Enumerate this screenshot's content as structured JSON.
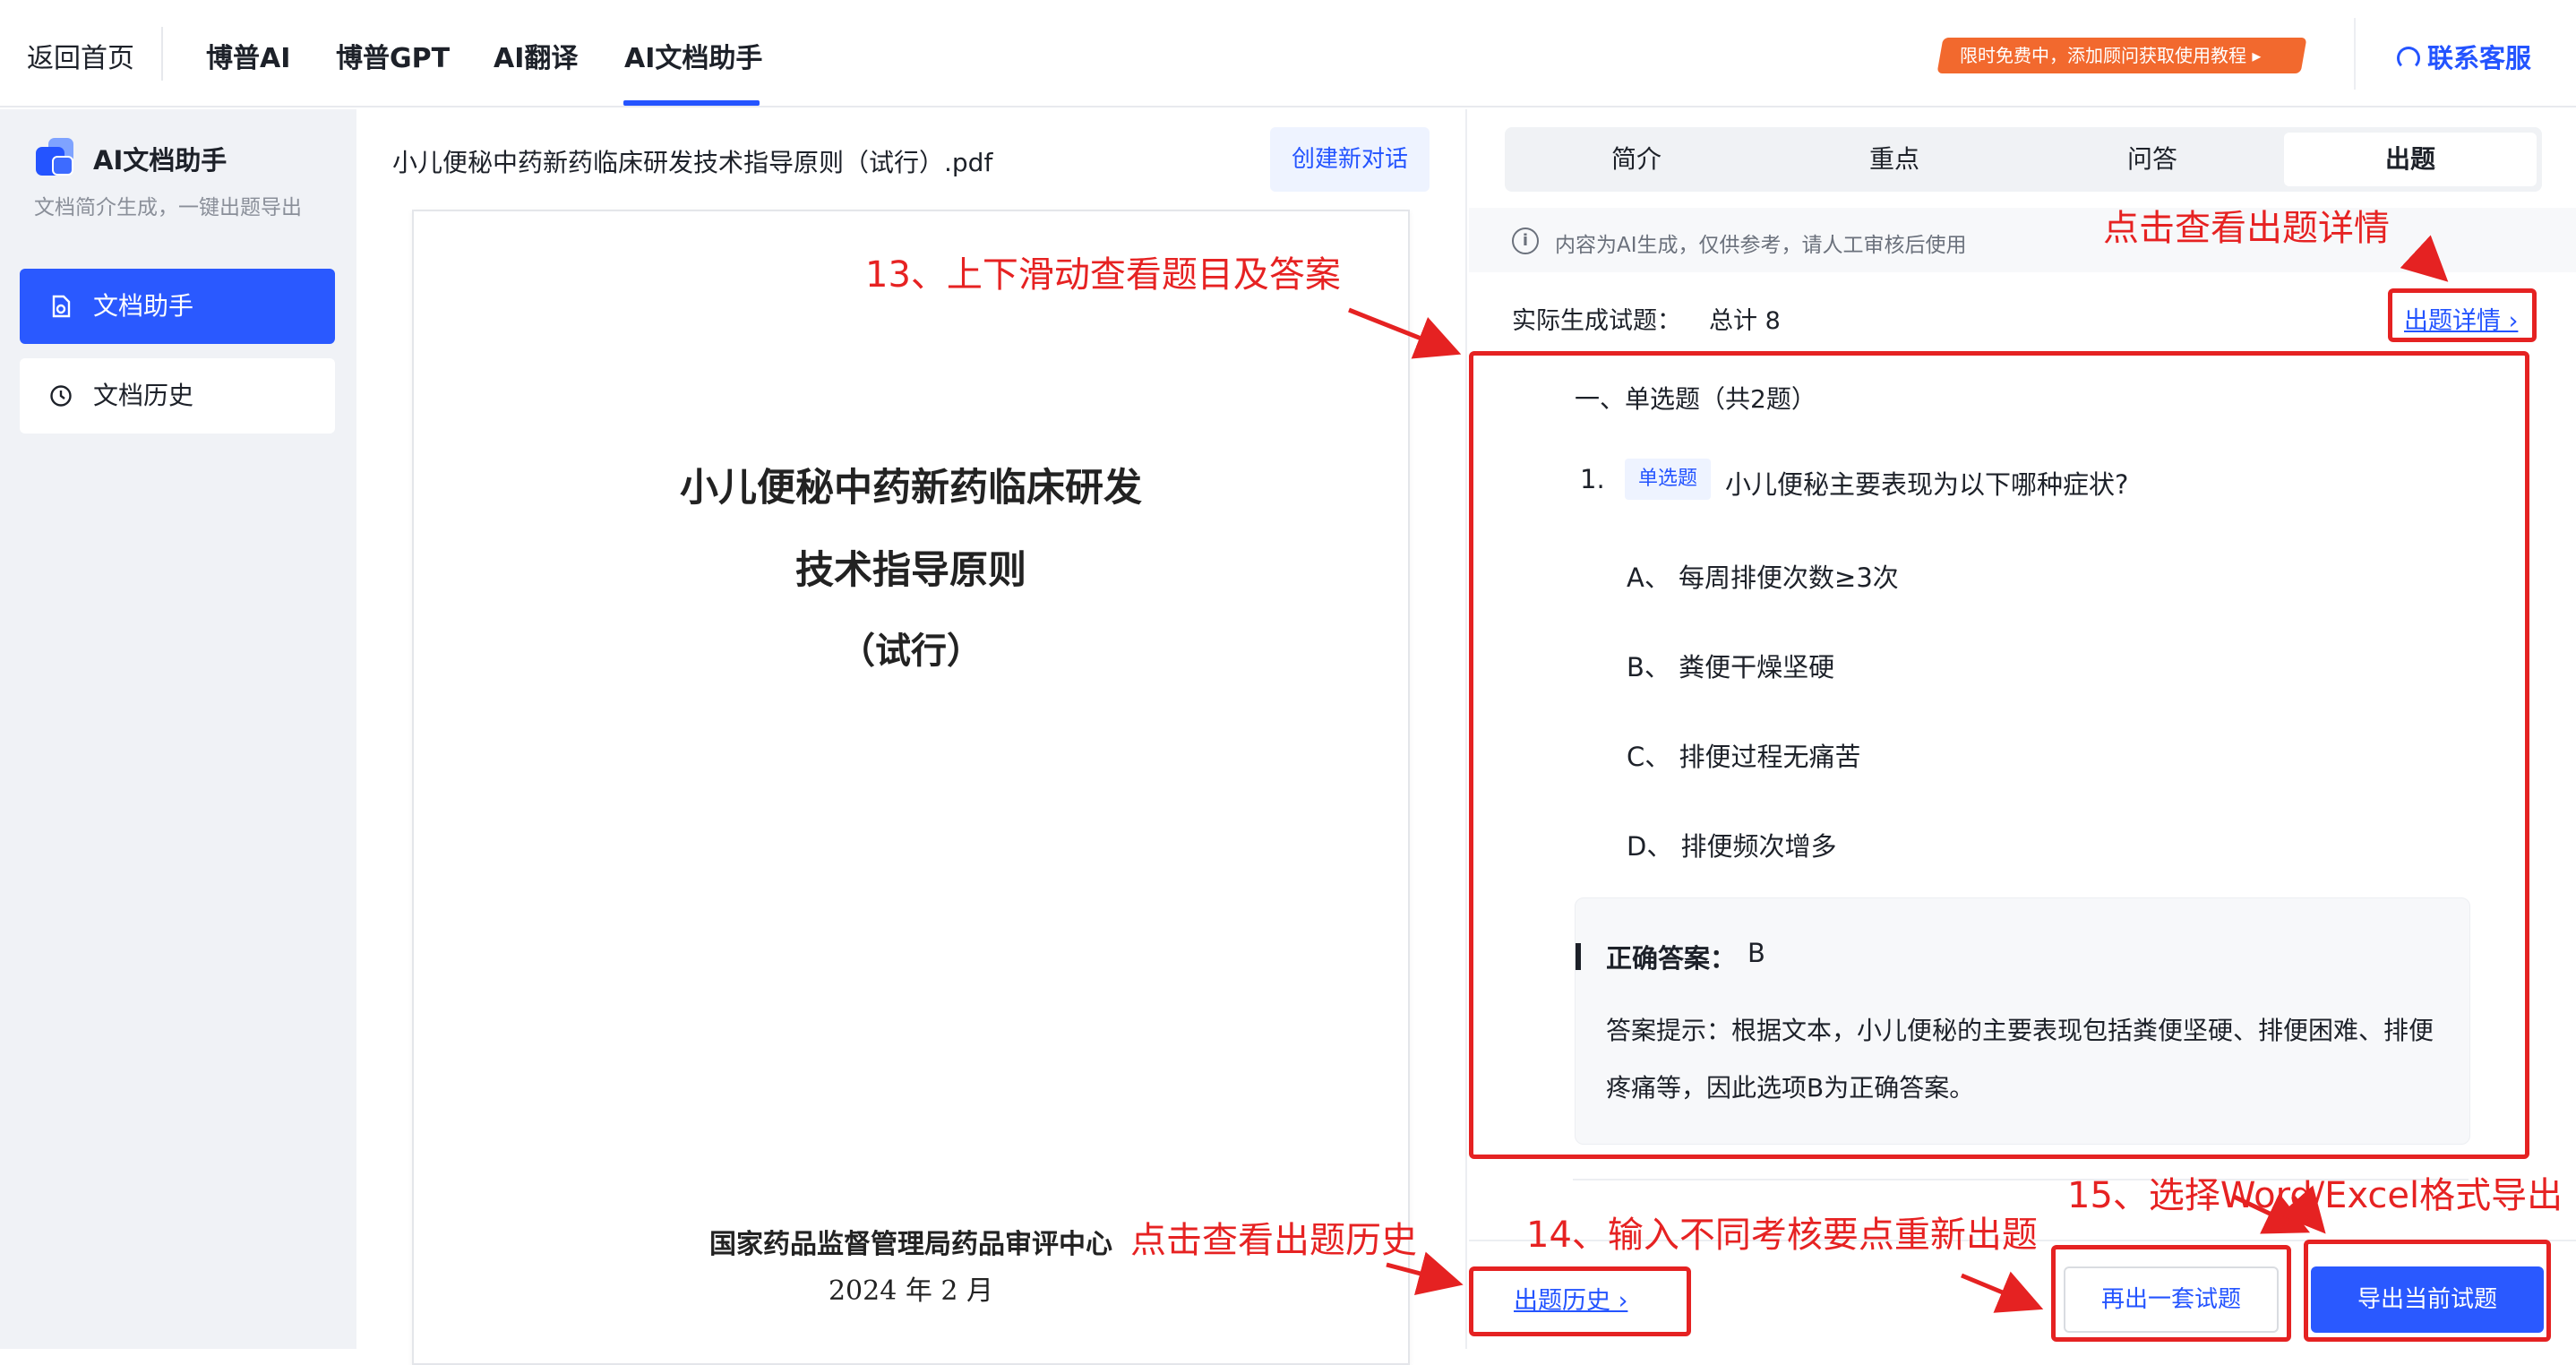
{
  "topbar": {
    "back_label": "返回首页",
    "nav": [
      "博普AI",
      "博普GPT",
      "AI翻译",
      "AI文档助手"
    ],
    "promo": "限时免费中，添加顾问获取使用教程 ▸",
    "service": "联系客服"
  },
  "sidebar": {
    "title": "AI文档助手",
    "subtitle": "文档简介生成，一键出题导出",
    "items": [
      {
        "label": "文档助手",
        "active": true
      },
      {
        "label": "文档历史",
        "active": false
      }
    ]
  },
  "document": {
    "file_name": "小儿便秘中药新药临床研发技术指导原则（试行）.pdf",
    "new_chat_label": "创建新对话",
    "page": {
      "title_line1": "小儿便秘中药新药临床研发",
      "title_line2": "技术指导原则",
      "title_line3": "（试行）",
      "org": "国家药品监督管理局药品审评中心",
      "date": "2024 年 2 月"
    }
  },
  "panel": {
    "tabs": [
      "简介",
      "重点",
      "问答",
      "出题"
    ],
    "active_tab": "出题",
    "notice": "内容为AI生成，仅供参考，请人工审核后使用",
    "generated_label": "实际生成试题：",
    "generated_count": "总计 8",
    "detail_link": "出题详情 ›",
    "section_title": "一、单选题（共2题）",
    "question": {
      "number": "1.",
      "type_badge": "单选题",
      "text": "小儿便秘主要表现为以下哪种症状?",
      "options": [
        "A、 每周排便次数≥3次",
        "B、 粪便干燥坚硬",
        "C、 排便过程无痛苦",
        "D、 排便频次增多"
      ],
      "answer_label": "正确答案：",
      "answer_value": "B",
      "hint": "答案提示：根据文本，小儿便秘的主要表现包括粪便坚硬、排便困难、排便疼痛等，因此选项B为正确答案。"
    },
    "history_link": "出题历史 ›",
    "again_button": "再出一套试题",
    "export_button": "导出当前试题"
  },
  "annotations": {
    "scroll": "13、上下滑动查看题目及答案",
    "detail": "点击查看出题详情",
    "history": "点击查看出题历史",
    "requirements": "14、输入不同考核要点重新出题",
    "export": "15、选择Word/Excel格式导出"
  },
  "colors": {
    "accent": "#2454ff",
    "promo": "#f2692e",
    "annotation": "#e52222"
  }
}
